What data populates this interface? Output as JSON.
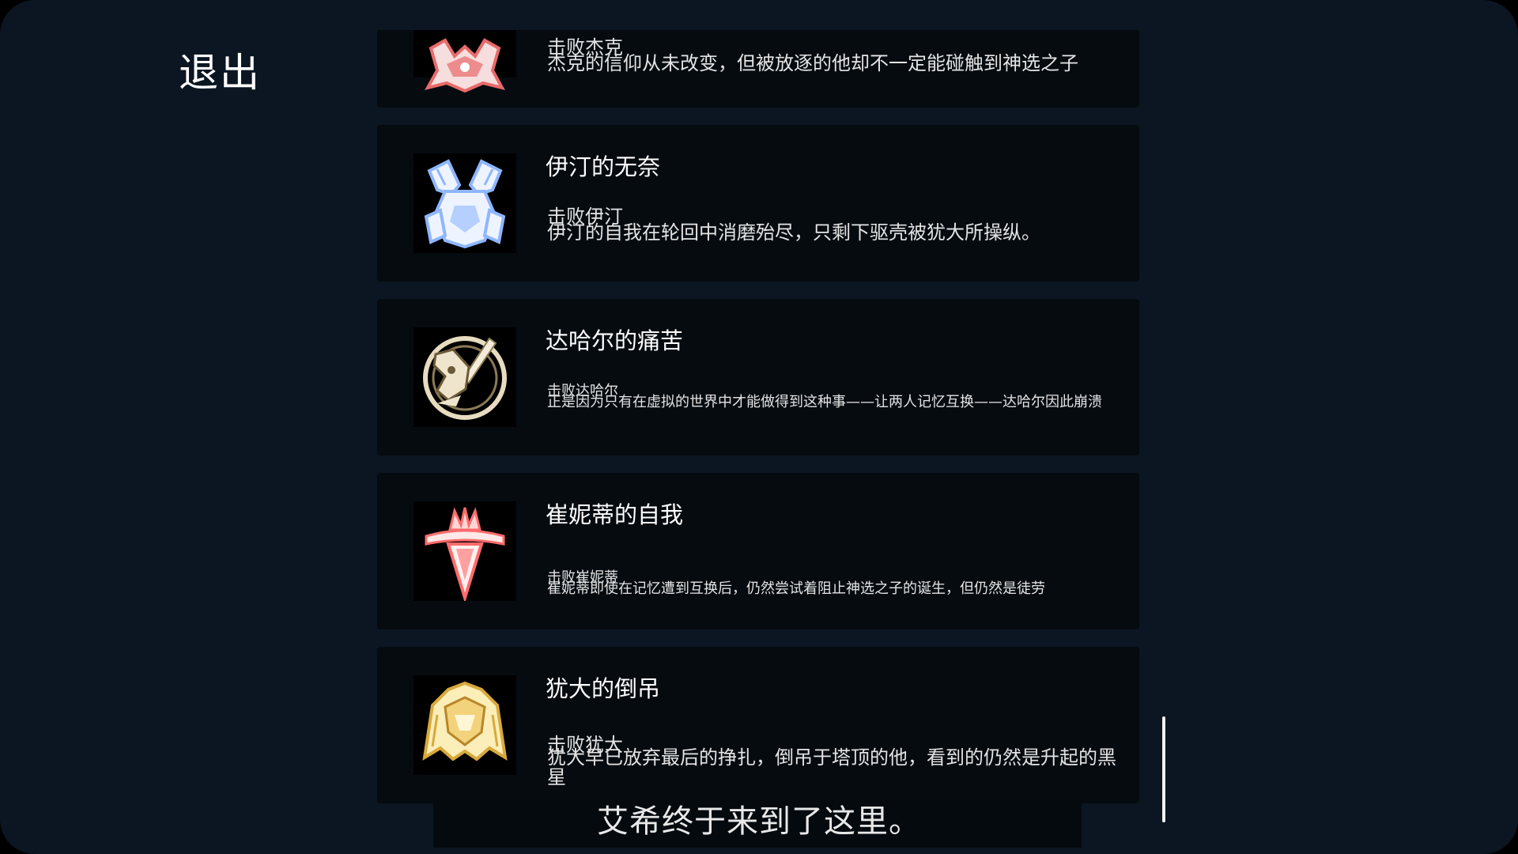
{
  "header": {
    "exit_label": "退出"
  },
  "achievements": [
    {
      "title": "",
      "condition": "击败杰克",
      "description": "杰克的信仰从未改变，但被放逐的他却不一定能碰触到神选之子",
      "icon": "jack-emblem-icon"
    },
    {
      "title": "伊汀的无奈",
      "condition": "击败伊汀",
      "description": "伊汀的自我在轮回中消磨殆尽，只剩下驱壳被犹大所操纵。",
      "icon": "edin-emblem-icon"
    },
    {
      "title": "达哈尔的痛苦",
      "condition": "击败达哈尔",
      "description": "正是因为只有在虚拟的世界中才能做得到这种事——让两人记忆互换——达哈尔因此崩溃",
      "icon": "dahar-emblem-icon"
    },
    {
      "title": "崔妮蒂的自我",
      "condition": "击败崔妮蒂",
      "description": "崔妮蒂即使在记忆遭到互换后，仍然尝试着阻止神选之子的诞生，但仍然是徒劳",
      "icon": "trinity-emblem-icon"
    },
    {
      "title": "犹大的倒吊",
      "condition": "击败犹大",
      "description": "犹大早已放弃最后的挣扎，倒吊于塔顶的他，看到的仍然是升起的黑星",
      "icon": "judas-emblem-icon"
    }
  ],
  "subtitle": {
    "text": "艾希终于来到了这里。"
  },
  "colors": {
    "background": "#0b1622",
    "card": "#060b10",
    "text": "#ffffff",
    "jack_icon": "#e86a6a",
    "edin_icon": "#8fb6ff",
    "dahar_icon": "#e8dcc0",
    "trinity_icon": "#ff6b6b",
    "judas_icon": "#f2d27a"
  }
}
